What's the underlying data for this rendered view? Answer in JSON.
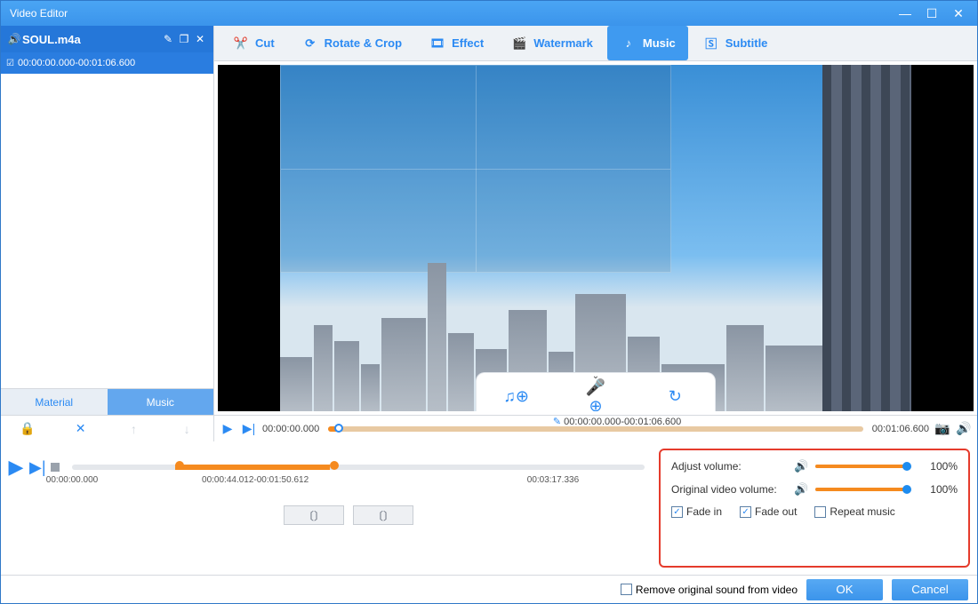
{
  "window": {
    "title": "Video Editor"
  },
  "sidebar": {
    "file_name": "SOUL.m4a",
    "clip_range": "00:00:00.000-00:01:06.600",
    "tabs": {
      "material": "Material",
      "music": "Music"
    }
  },
  "toolbar": {
    "cut": "Cut",
    "rotate": "Rotate & Crop",
    "effect": "Effect",
    "watermark": "Watermark",
    "music": "Music",
    "subtitle": "Subtitle"
  },
  "preview_timeline": {
    "start": "00:00:00.000",
    "center": "00:00:00.000-00:01:06.600",
    "end": "00:01:06.600"
  },
  "bottom_timeline": {
    "start": "00:00:00.000",
    "segment": "00:00:44.012-00:01:50.612",
    "end": "00:03:17.336"
  },
  "volume": {
    "adjust_label": "Adjust volume:",
    "adjust_value": "100%",
    "original_label": "Original video volume:",
    "original_value": "100%",
    "fade_in": "Fade in",
    "fade_out": "Fade out",
    "repeat": "Repeat music"
  },
  "footer": {
    "remove_sound": "Remove original sound from video",
    "ok": "OK",
    "cancel": "Cancel"
  }
}
